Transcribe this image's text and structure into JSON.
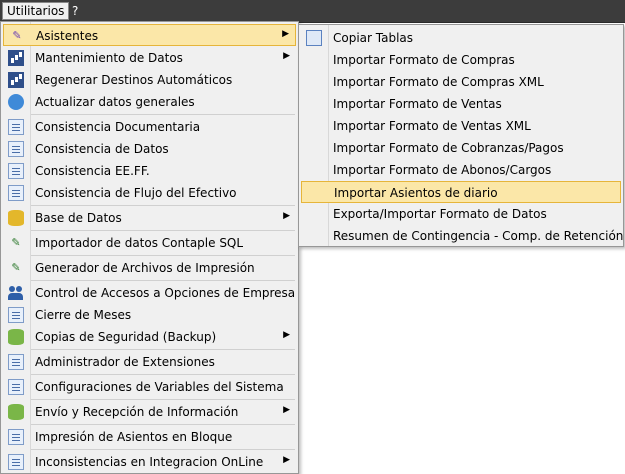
{
  "menubar": {
    "items": [
      {
        "label": "Utilitarios",
        "active": true
      },
      {
        "label": "?",
        "active": false
      }
    ]
  },
  "main_menu": {
    "items": [
      {
        "label": "Asistentes",
        "icon": "wand-icon",
        "submenu": true,
        "highlighted": true
      },
      {
        "label": "Mantenimiento de Datos",
        "icon": "chart-icon",
        "submenu": true
      },
      {
        "label": "Regenerar Destinos Automáticos",
        "icon": "chart-icon",
        "submenu": false
      },
      {
        "label": "Actualizar datos generales",
        "icon": "globe-icon",
        "submenu": false
      },
      {
        "label": "Consistencia Documentaria",
        "icon": "document-icon",
        "submenu": false
      },
      {
        "label": "Consistencia de Datos",
        "icon": "document-icon",
        "submenu": false
      },
      {
        "label": "Consistencia EE.FF.",
        "icon": "document-icon",
        "submenu": false
      },
      {
        "label": "Consistencia de Flujo del Efectivo",
        "icon": "document-icon",
        "submenu": false
      },
      {
        "label": "Base de Datos",
        "icon": "database-icon",
        "submenu": true
      },
      {
        "label": "Importador de datos Contaple SQL",
        "icon": "edit-icon",
        "submenu": false
      },
      {
        "label": "Generador de Archivos de Impresión",
        "icon": "edit-icon",
        "submenu": false
      },
      {
        "label": "Control de Accesos a Opciones de Empresa",
        "icon": "users-icon",
        "submenu": false
      },
      {
        "label": "Cierre de Meses",
        "icon": "document-icon",
        "submenu": false
      },
      {
        "label": "Copias de Seguridad (Backup)",
        "icon": "database-icon",
        "submenu": true
      },
      {
        "label": "Administrador de Extensiones",
        "icon": "document-icon",
        "submenu": false
      },
      {
        "label": "Configuraciones de Variables del Sistema",
        "icon": "document-icon",
        "submenu": false
      },
      {
        "label": "Envío y Recepción de Información",
        "icon": "database-icon",
        "submenu": true
      },
      {
        "label": "Impresión de Asientos en Bloque",
        "icon": "document-icon",
        "submenu": false
      },
      {
        "label": "Inconsistencias en Integracion OnLine",
        "icon": "document-icon",
        "submenu": true
      }
    ]
  },
  "sub_menu": {
    "items": [
      {
        "label": "Copiar Tablas",
        "icon": "tables-icon"
      },
      {
        "label": "Importar Formato de Compras"
      },
      {
        "label": "Importar Formato de Compras XML"
      },
      {
        "label": "Importar Formato de Ventas"
      },
      {
        "label": "Importar Formato de Ventas XML"
      },
      {
        "label": "Importar Formato de Cobranzas/Pagos"
      },
      {
        "label": "Importar Formato de Abonos/Cargos"
      },
      {
        "label": "Importar Asientos de diario",
        "highlighted": true
      },
      {
        "label": "Exporta/Importar Formato de Datos"
      },
      {
        "label": "Resumen de Contingencia - Comp. de Retención"
      }
    ]
  },
  "colors": {
    "menubar": "#3c3c3c",
    "menu_bg": "#f0f0f0",
    "highlight": "#fbe7a8",
    "highlight_border": "#e6b53a"
  }
}
